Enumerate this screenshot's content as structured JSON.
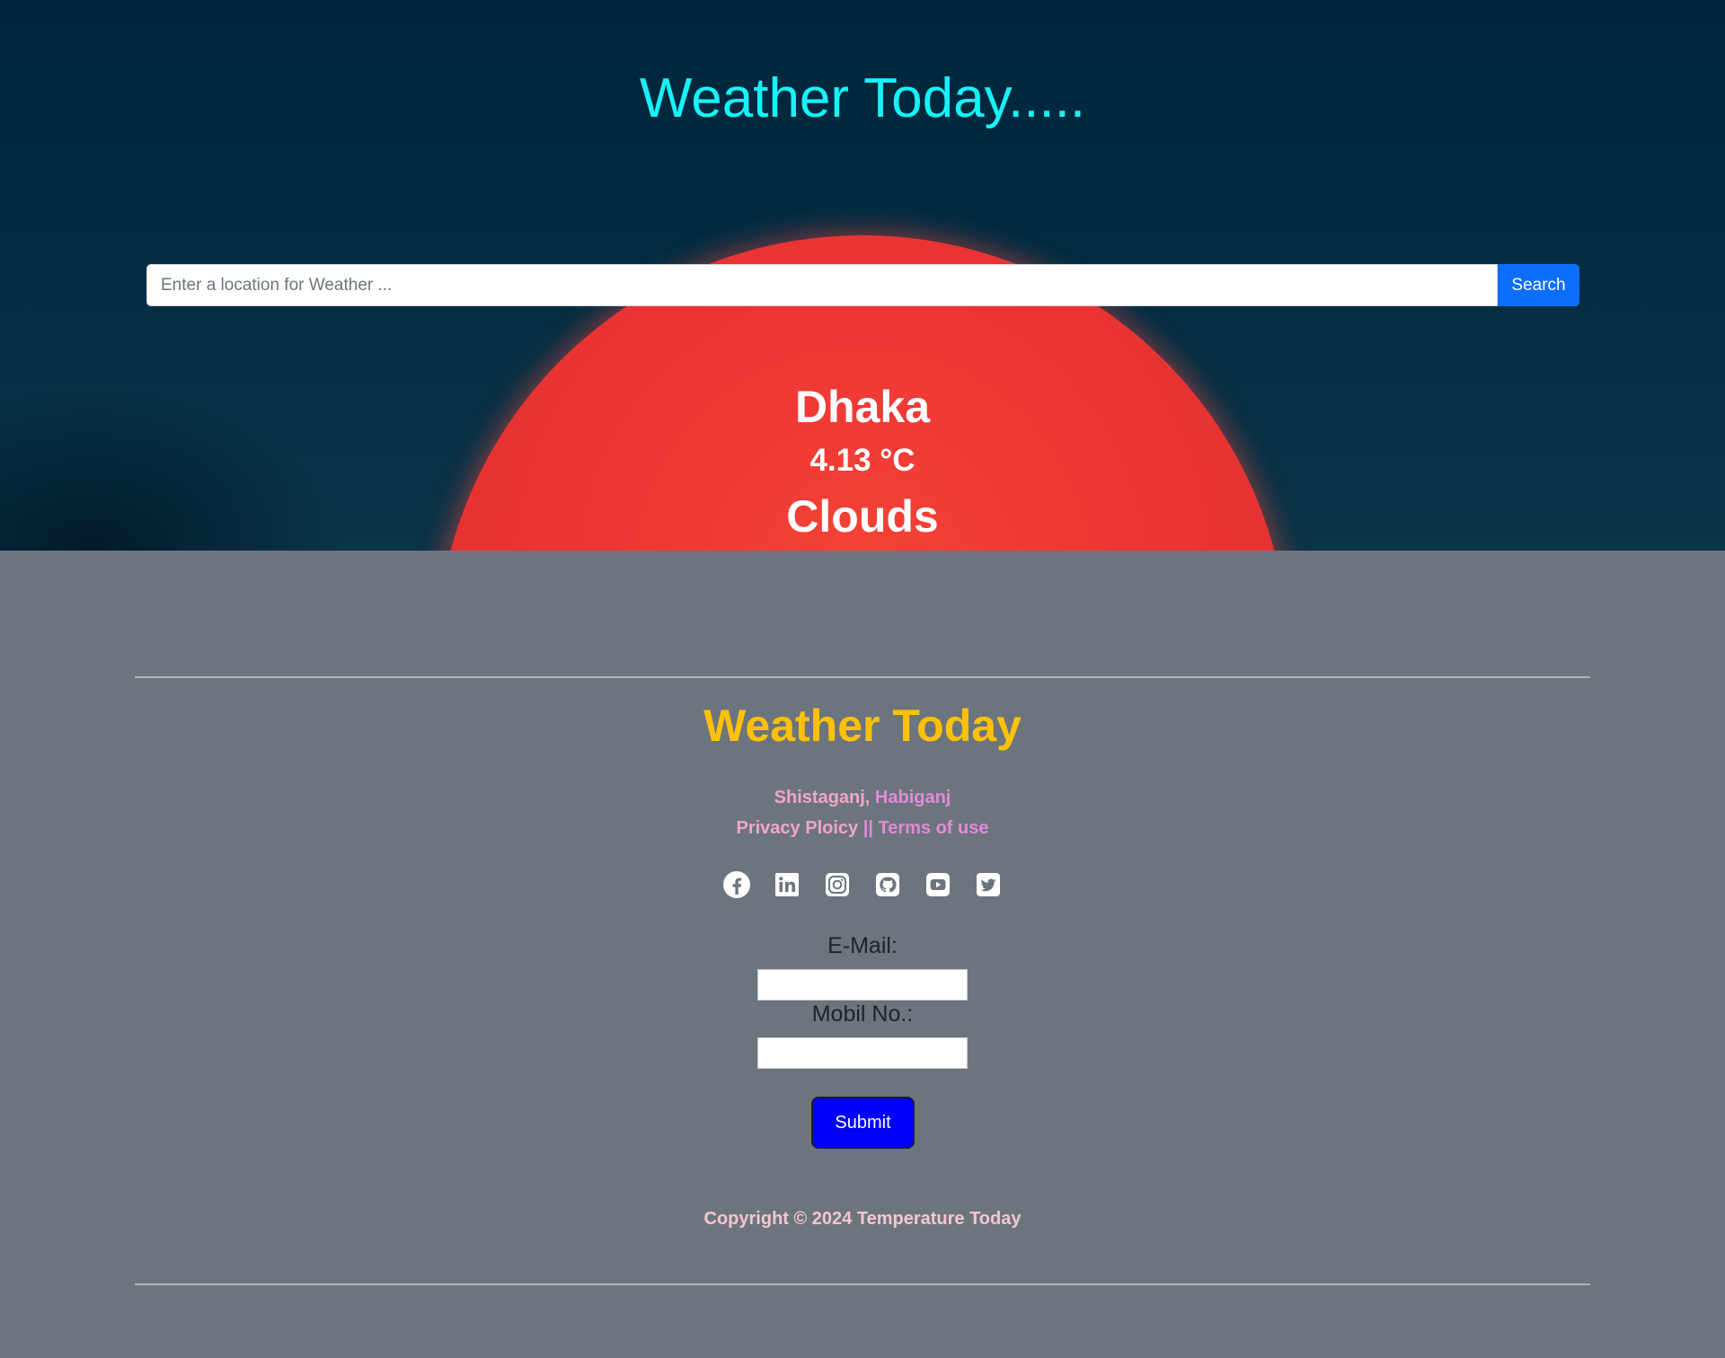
{
  "header": {
    "title": "Weather Today....."
  },
  "search": {
    "placeholder": "Enter a location for Weather ...",
    "button_label": "Search"
  },
  "weather": {
    "city": "Dhaka",
    "temperature": "4.13 °C",
    "condition": "Clouds"
  },
  "footer": {
    "title": "Weather Today",
    "address_part1": "Shistaganj,",
    "address_part2": "Habiganj",
    "privacy_label": "Privacy Ploicy",
    "separator": "||",
    "terms_label": "Terms of use",
    "socials": [
      "facebook-icon",
      "linkedin-icon",
      "instagram-icon",
      "github-icon",
      "youtube-icon",
      "twitter-icon"
    ],
    "email_label": "E-Mail:",
    "email_value": "",
    "mobile_label": "Mobil No.:",
    "mobile_value": "",
    "submit_label": "Submit",
    "copyright": "Copyright © 2024 Temperature Today"
  },
  "colors": {
    "hero_bg": "#00263b",
    "sun": "#ec3434",
    "title": "#16f3f7",
    "footer_bg": "#6c757d",
    "footer_title": "#ffc107",
    "search_button": "#0d6efd",
    "submit_button": "#0000ff"
  }
}
